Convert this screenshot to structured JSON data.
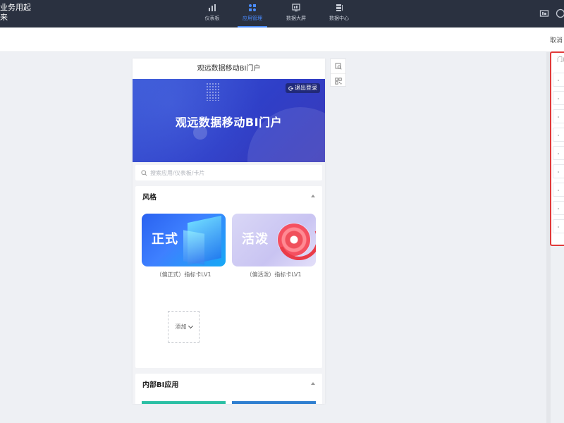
{
  "app": {
    "title_line1": "业务用起",
    "title_line2": "来"
  },
  "nav": {
    "tabs": [
      {
        "label": "仪表板",
        "icon": "bar-chart-icon",
        "active": false
      },
      {
        "label": "应用管理",
        "icon": "app-grid-icon",
        "active": true
      },
      {
        "label": "数据大屏",
        "icon": "monitor-icon",
        "active": false
      },
      {
        "label": "数据中心",
        "icon": "database-icon",
        "active": false
      }
    ]
  },
  "toolbar": {
    "cancel_label": "取消"
  },
  "phone": {
    "title": "观远数据移动BI门户",
    "banner_title": "观远数据移动BI门户",
    "logout_label": "退出登录",
    "search_placeholder": "搜索应用/仪表板/卡片",
    "style_section": {
      "title": "风格",
      "items": [
        {
          "thumb_text": "正式",
          "caption": "（偏正式）指标卡LV1"
        },
        {
          "thumb_text": "活泼",
          "caption": "（偏活泼）指标卡LV1"
        }
      ],
      "add_label": "添加"
    },
    "inner_section": {
      "title": "内部BI应用"
    }
  },
  "right_panel": {
    "placeholder": "门户"
  },
  "colors": {
    "topbar": "#2a3140",
    "accent": "#4a8cff",
    "highlight_border": "#e03a3a",
    "teal_bar": "#2bbfa4",
    "blue_bar": "#2f7fd0"
  }
}
